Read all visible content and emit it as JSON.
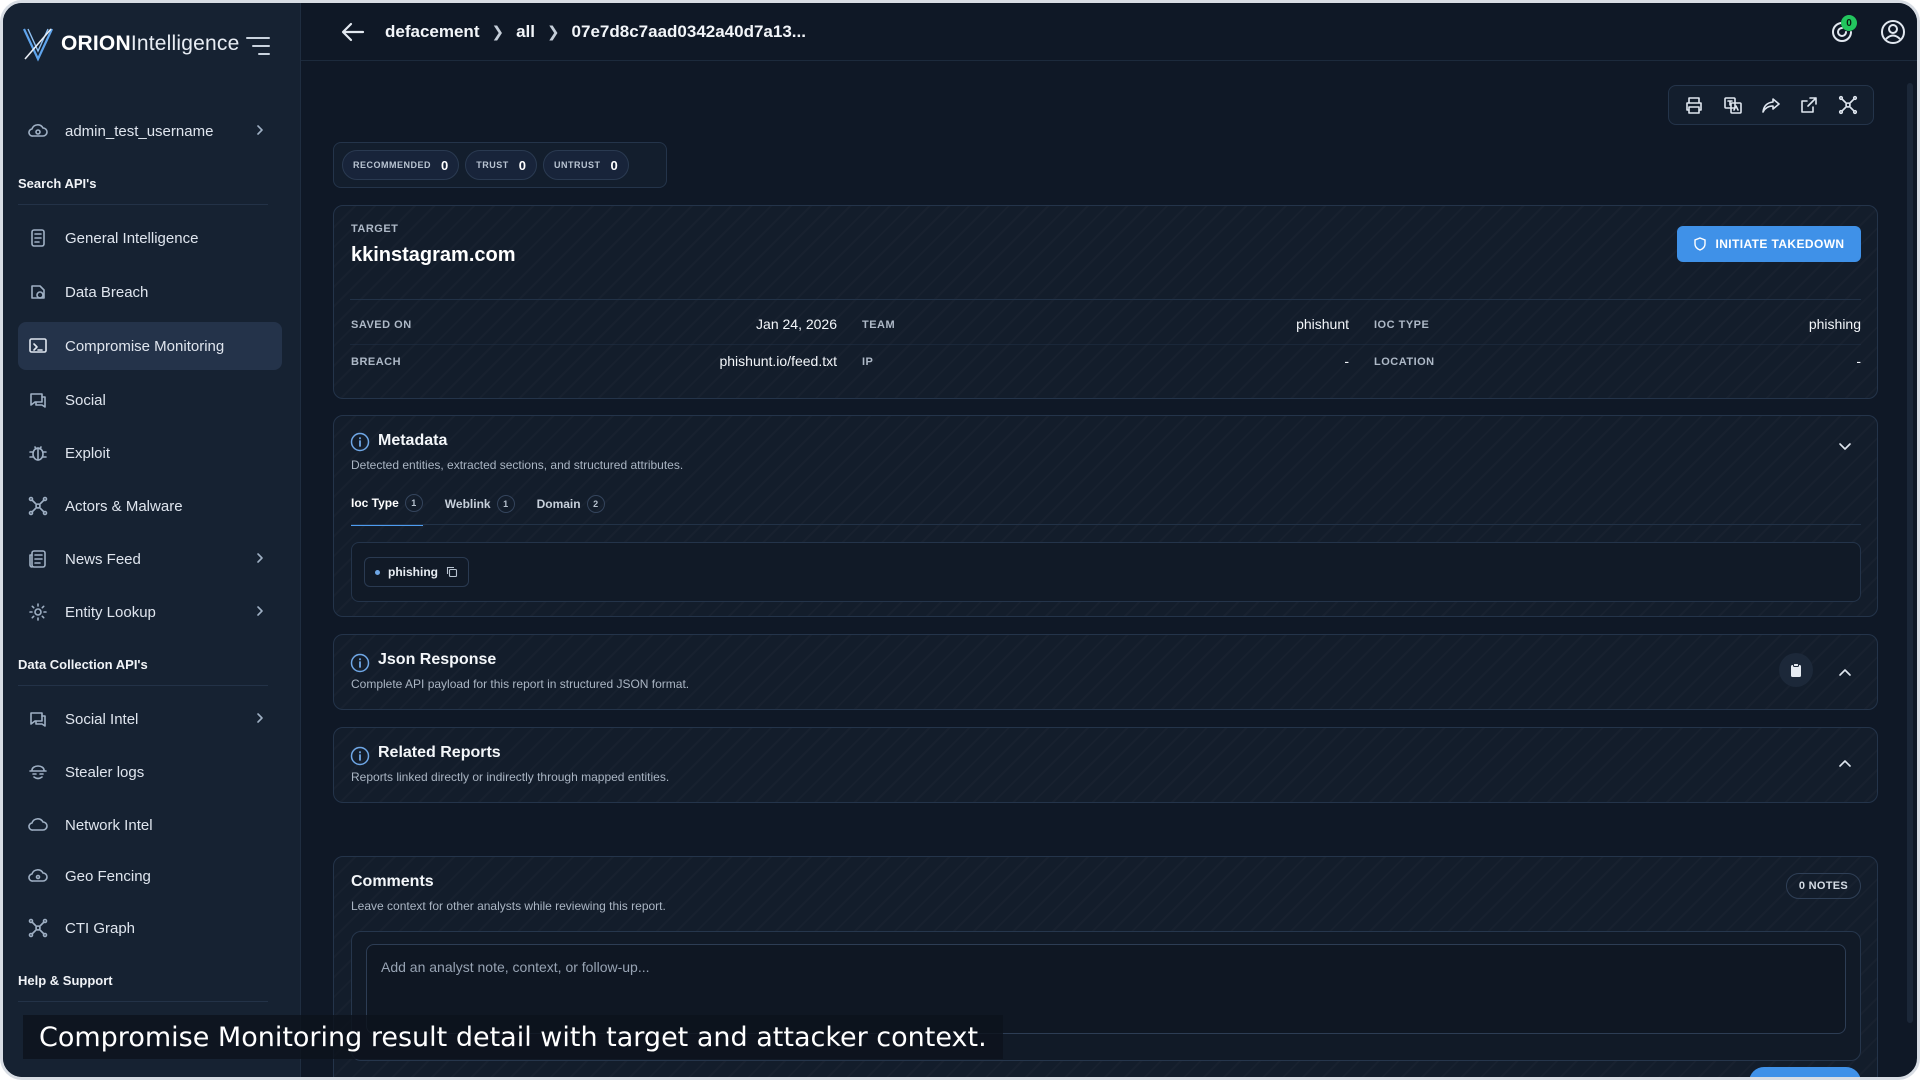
{
  "app": {
    "logo_bold": "ORION",
    "logo_rest": "Intelligence"
  },
  "sidebar": {
    "account": "admin_test_username",
    "sections": {
      "search": "Search API's",
      "collection": "Data Collection API's",
      "help": "Help & Support"
    },
    "search_items": [
      {
        "label": "General Intelligence",
        "icon": "report-icon"
      },
      {
        "label": "Data Breach",
        "icon": "breach-icon"
      },
      {
        "label": "Compromise Monitoring",
        "icon": "monitor-icon",
        "active": true
      },
      {
        "label": "Social",
        "icon": "social-icon"
      },
      {
        "label": "Exploit",
        "icon": "bug-icon"
      },
      {
        "label": "Actors & Malware",
        "icon": "network-icon"
      },
      {
        "label": "News Feed",
        "icon": "news-icon",
        "has_children": true
      },
      {
        "label": "Entity Lookup",
        "icon": "gear-icon",
        "has_children": true
      }
    ],
    "collection_items": [
      {
        "label": "Social Intel",
        "icon": "social-icon",
        "has_children": true
      },
      {
        "label": "Stealer logs",
        "icon": "stealer-icon"
      },
      {
        "label": "Network Intel",
        "icon": "cloud-icon"
      },
      {
        "label": "Geo Fencing",
        "icon": "geo-icon"
      },
      {
        "label": "CTI Graph",
        "icon": "graph-icon"
      }
    ]
  },
  "breadcrumb": [
    "defacement",
    "all",
    "07e7d8c7aad0342a40d7a13..."
  ],
  "notifications": {
    "count": "0"
  },
  "scores": {
    "recommended": {
      "label": "RECOMMENDED",
      "value": "0"
    },
    "trust": {
      "label": "TRUST",
      "value": "0"
    },
    "untrust": {
      "label": "UNTRUST",
      "value": "0"
    }
  },
  "target": {
    "label": "TARGET",
    "name": "kkinstagram.com",
    "takedown_label": "INITIATE TAKEDOWN",
    "fields": {
      "saved_on": {
        "label": "SAVED ON",
        "value": "Jan 24, 2026"
      },
      "team": {
        "label": "TEAM",
        "value": "phishunt"
      },
      "ioc_type": {
        "label": "IOC TYPE",
        "value": "phishing"
      },
      "breach": {
        "label": "BREACH",
        "value": "phishunt.io/feed.txt"
      },
      "ip": {
        "label": "IP",
        "value": "-"
      },
      "location": {
        "label": "LOCATION",
        "value": "-"
      }
    }
  },
  "metadata": {
    "title": "Metadata",
    "subtitle": "Detected entities, extracted sections, and structured attributes.",
    "tabs": [
      {
        "label": "Ioc Type",
        "count": "1",
        "active": true
      },
      {
        "label": "Weblink",
        "count": "1"
      },
      {
        "label": "Domain",
        "count": "2"
      }
    ],
    "chips": [
      "phishing"
    ]
  },
  "json_response": {
    "title": "Json Response",
    "subtitle": "Complete API payload for this report in structured JSON format."
  },
  "related": {
    "title": "Related Reports",
    "subtitle": "Reports linked directly or indirectly through mapped entities."
  },
  "comments": {
    "title": "Comments",
    "subtitle": "Leave context for other analysts while reviewing this report.",
    "notes": "0 NOTES",
    "placeholder": "Add an analyst note, context, or follow-up..."
  },
  "caption": "Compromise Monitoring result detail with target and attacker context.",
  "colors": {
    "accent": "#3f91e8",
    "background": "#0f1826",
    "sidebar": "#162232",
    "badge": "#22c55e"
  }
}
